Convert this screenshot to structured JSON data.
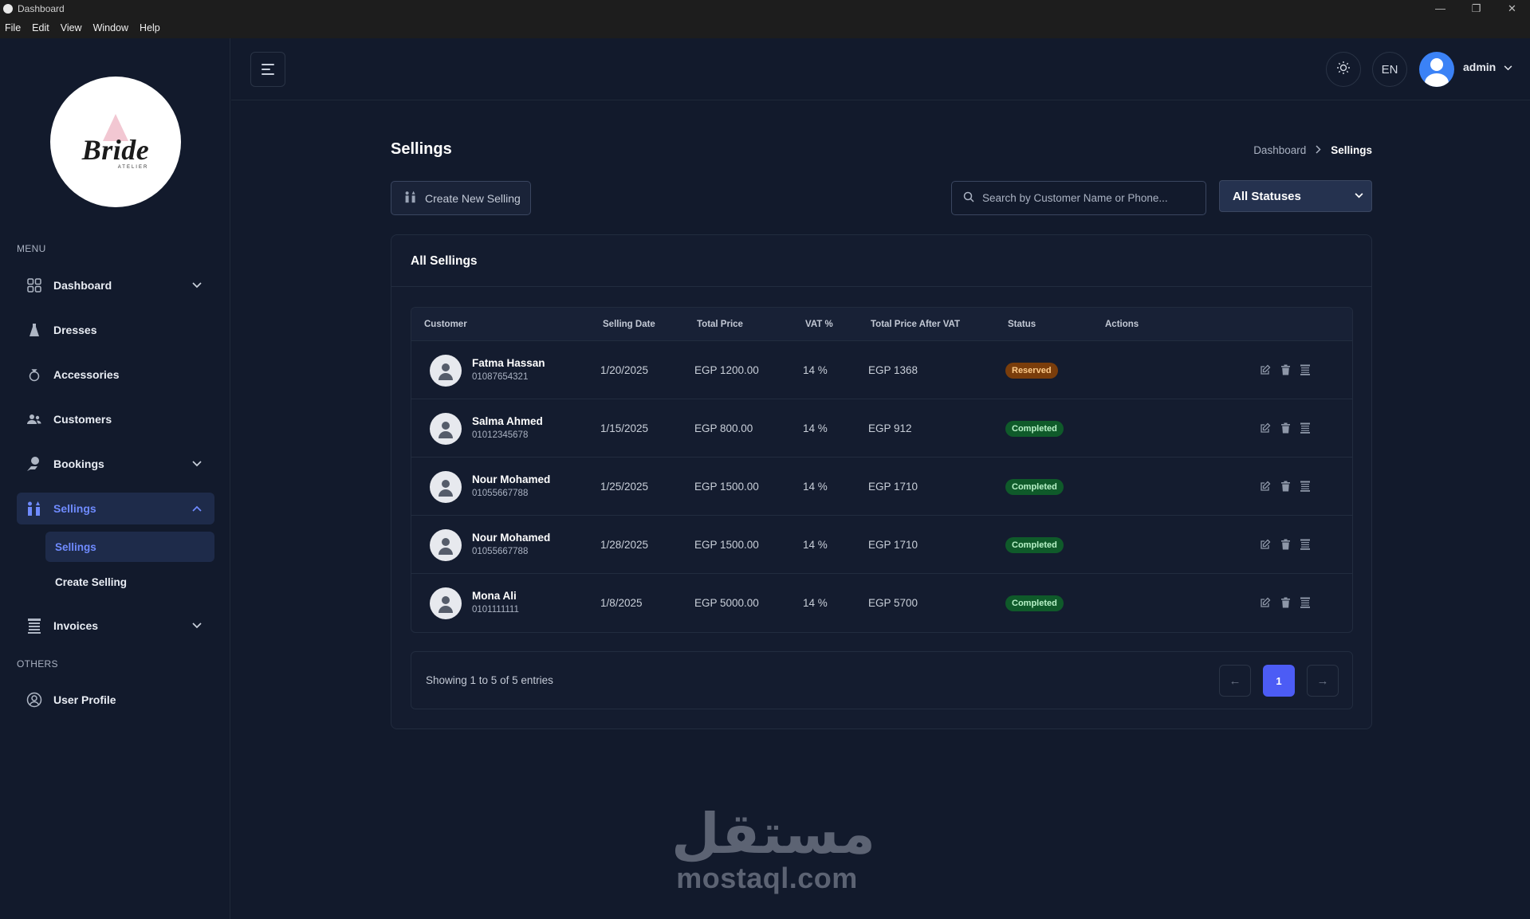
{
  "window": {
    "title": "Dashboard",
    "menu": [
      "File",
      "Edit",
      "View",
      "Window",
      "Help"
    ],
    "controls": [
      "—",
      "❐",
      "✕"
    ]
  },
  "sidebar": {
    "logo_text": "Bride",
    "logo_sub": "ATELIER",
    "menu_label": "MENU",
    "others_label": "OTHERS",
    "items": [
      {
        "label": "Dashboard",
        "icon": "grid-icon"
      },
      {
        "label": "Dresses",
        "icon": "dress-icon"
      },
      {
        "label": "Accessories",
        "icon": "ring-icon"
      },
      {
        "label": "Customers",
        "icon": "users-icon"
      },
      {
        "label": "Bookings",
        "icon": "booking-icon"
      },
      {
        "label": "Sellings",
        "icon": "sellings-icon"
      },
      {
        "label": "Invoices",
        "icon": "invoice-icon"
      },
      {
        "label": "User Profile",
        "icon": "user-circle-icon"
      }
    ],
    "sub_items": [
      "Sellings",
      "Create Selling"
    ]
  },
  "header": {
    "language": "EN",
    "username": "admin"
  },
  "page": {
    "title": "Sellings",
    "breadcrumb": {
      "home": "Dashboard",
      "current": "Sellings"
    },
    "create_button": "Create New Selling",
    "search_placeholder": "Search by Customer Name or Phone...",
    "status_filter": "All Statuses",
    "card_title": "All Sellings"
  },
  "table": {
    "columns": [
      "Customer",
      "Selling Date",
      "Total Price",
      "VAT %",
      "Total Price After VAT",
      "Status",
      "Actions"
    ],
    "rows": [
      {
        "name": "Fatma Hassan",
        "phone": "01087654321",
        "date": "1/20/2025",
        "total": "EGP 1200.00",
        "vat": "14 %",
        "after_vat": "EGP 1368",
        "status": "Reserved"
      },
      {
        "name": "Salma Ahmed",
        "phone": "01012345678",
        "date": "1/15/2025",
        "total": "EGP 800.00",
        "vat": "14 %",
        "after_vat": "EGP 912",
        "status": "Completed"
      },
      {
        "name": "Nour Mohamed",
        "phone": "01055667788",
        "date": "1/25/2025",
        "total": "EGP 1500.00",
        "vat": "14 %",
        "after_vat": "EGP 1710",
        "status": "Completed"
      },
      {
        "name": "Nour Mohamed",
        "phone": "01055667788",
        "date": "1/28/2025",
        "total": "EGP 1500.00",
        "vat": "14 %",
        "after_vat": "EGP 1710",
        "status": "Completed"
      },
      {
        "name": "Mona Ali",
        "phone": "0101111111",
        "date": "1/8/2025",
        "total": "EGP 5000.00",
        "vat": "14 %",
        "after_vat": "EGP 5700",
        "status": "Completed"
      }
    ]
  },
  "pagination": {
    "summary": "Showing 1 to 5 of 5 entries",
    "prev": "←",
    "current": "1",
    "next": "→"
  },
  "watermark": {
    "arabic": "مستقل",
    "latin": "mostaql.com"
  },
  "colors": {
    "accent": "#4c5cf5",
    "active_nav": "#6f8bff",
    "reserved": "#7a3d0b",
    "completed": "#0f5a2a"
  }
}
